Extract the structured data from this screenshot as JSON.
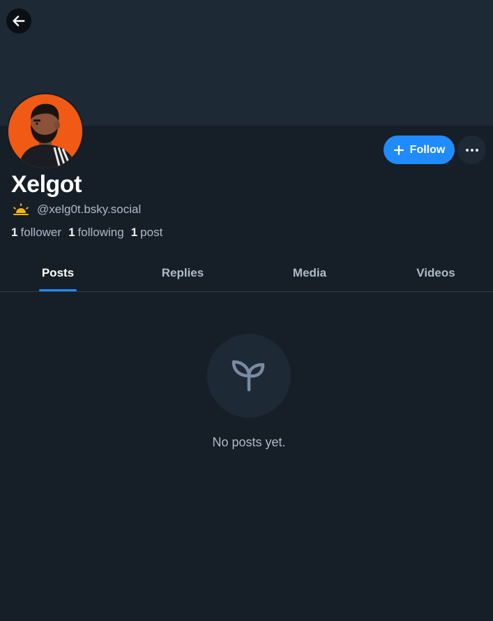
{
  "header": {
    "back_icon": "arrow-left-icon"
  },
  "profile": {
    "display_name": "Xelgot",
    "handle": "@xelg0t.bsky.social",
    "status_icon": "sunrise-icon",
    "avatar_icon": "avatar-illustration",
    "stats": {
      "followers_count": "1",
      "followers_label": "follower",
      "following_count": "1",
      "following_label": "following",
      "posts_count": "1",
      "posts_label": "post"
    }
  },
  "actions": {
    "follow_label": "Follow",
    "more_icon": "ellipsis-icon"
  },
  "tabs": [
    {
      "label": "Posts",
      "active": true
    },
    {
      "label": "Replies",
      "active": false
    },
    {
      "label": "Media",
      "active": false
    },
    {
      "label": "Videos",
      "active": false
    }
  ],
  "empty_state": {
    "icon": "sprout-icon",
    "message": "No posts yet."
  },
  "colors": {
    "background": "#161e27",
    "banner": "#1e2936",
    "accent": "#208bfe",
    "avatar_bg": "#f05a14"
  }
}
